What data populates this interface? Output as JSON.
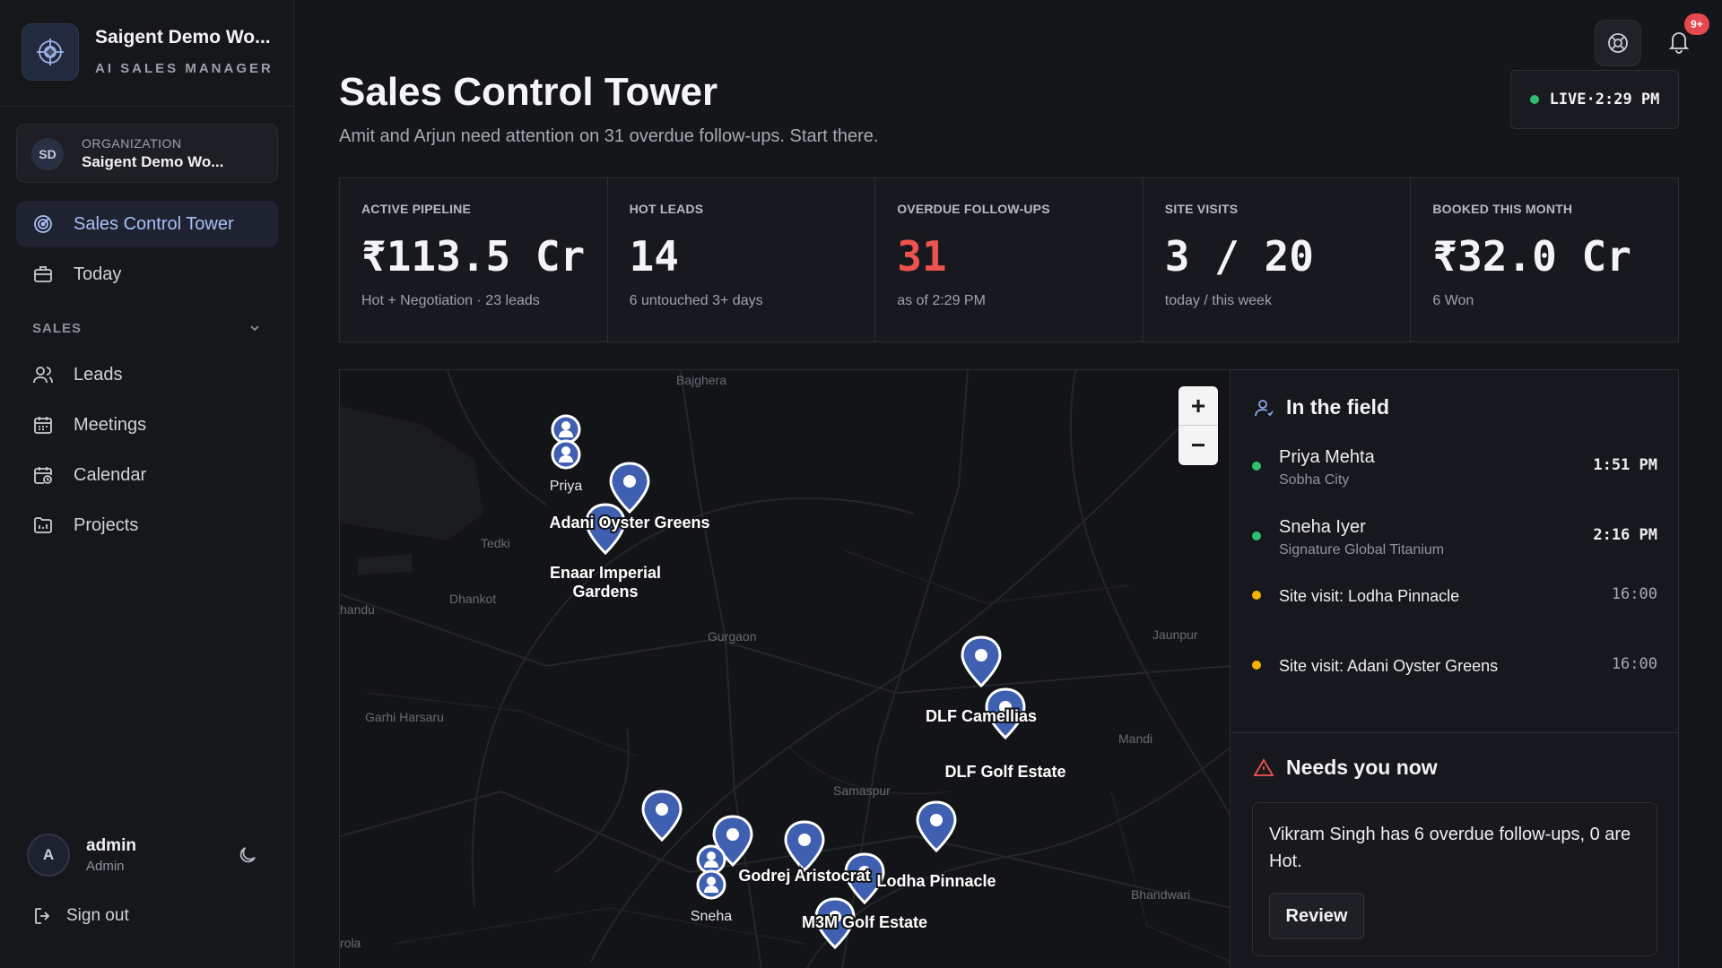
{
  "brand": {
    "name": "Saigent Demo Wo...",
    "subtitle": "AI SALES MANAGER",
    "logo_icon": "crosshair-logo-icon"
  },
  "organization": {
    "label": "ORGANIZATION",
    "name": "Saigent Demo Wo...",
    "avatar": "SD"
  },
  "nav": {
    "primary": [
      {
        "label": "Sales Control Tower",
        "icon": "radar-icon",
        "active": true
      },
      {
        "label": "Today",
        "icon": "briefcase-icon",
        "active": false
      }
    ],
    "section_label": "SALES",
    "sales": [
      {
        "label": "Leads",
        "icon": "users-icon"
      },
      {
        "label": "Meetings",
        "icon": "calendar-grid-icon"
      },
      {
        "label": "Calendar",
        "icon": "calendar-clock-icon"
      },
      {
        "label": "Projects",
        "icon": "folder-icon"
      }
    ]
  },
  "user": {
    "name": "admin",
    "role": "Admin",
    "avatar": "A"
  },
  "signout_label": "Sign out",
  "header": {
    "title": "Sales Control Tower",
    "subtitle": "Amit and Arjun need attention on 31 overdue follow-ups. Start there.",
    "live_label": "LIVE·2:29 PM",
    "notification_badge": "9+"
  },
  "kpis": [
    {
      "label": "ACTIVE PIPELINE",
      "value": "₹113.5 Cr",
      "sub": "Hot + Negotiation · 23 leads"
    },
    {
      "label": "HOT LEADS",
      "value": "14",
      "sub": "6 untouched 3+ days"
    },
    {
      "label": "OVERDUE FOLLOW-UPS",
      "value": "31",
      "sub": "as of 2:29 PM",
      "alert": true
    },
    {
      "label": "SITE VISITS",
      "value": "3 / 20",
      "sub": "today / this week"
    },
    {
      "label": "BOOKED THIS MONTH",
      "value": "₹32.0 Cr",
      "sub": "6 Won"
    }
  ],
  "map": {
    "places": [
      "Bajghera",
      "Tedki",
      "Dhankot",
      "handu",
      "Gurgaon",
      "Garhi Harsaru",
      "Jaunpur",
      "Mandi",
      "Samaspur",
      "Bhandwari",
      "rola"
    ],
    "pins": [
      "Adani Oyster Greens",
      "Enaar Imperial Gardens",
      "DLF Camellias",
      "DLF Golf Estate",
      "Godrej Aristocrat",
      "Lodha Pinnacle",
      "M3M Golf Estate"
    ],
    "people": [
      "Priya",
      "Sneha"
    ],
    "zoom_in": "+",
    "zoom_out": "−"
  },
  "field": {
    "title": "In the field",
    "items": [
      {
        "name": "Priya Mehta",
        "place": "Sobha City",
        "time": "1:51 PM",
        "color": "#2fbf71"
      },
      {
        "name": "Sneha Iyer",
        "place": "Signature Global Titanium",
        "time": "2:16 PM",
        "color": "#2fbf71"
      },
      {
        "name": "Site visit: Lodha Pinnacle",
        "time": "16:00",
        "color": "#f5b301"
      },
      {
        "name": "Site visit: Adani Oyster Greens",
        "time": "16:00",
        "color": "#f5b301"
      }
    ]
  },
  "needs": {
    "title": "Needs you now",
    "message": "Vikram Singh has 6 overdue follow-ups, 0 are Hot.",
    "button": "Review"
  },
  "colors": {
    "accent": "#a9c0f7",
    "alert": "#ef5350",
    "live": "#2fbf71",
    "pin": "#3f5fb0"
  }
}
